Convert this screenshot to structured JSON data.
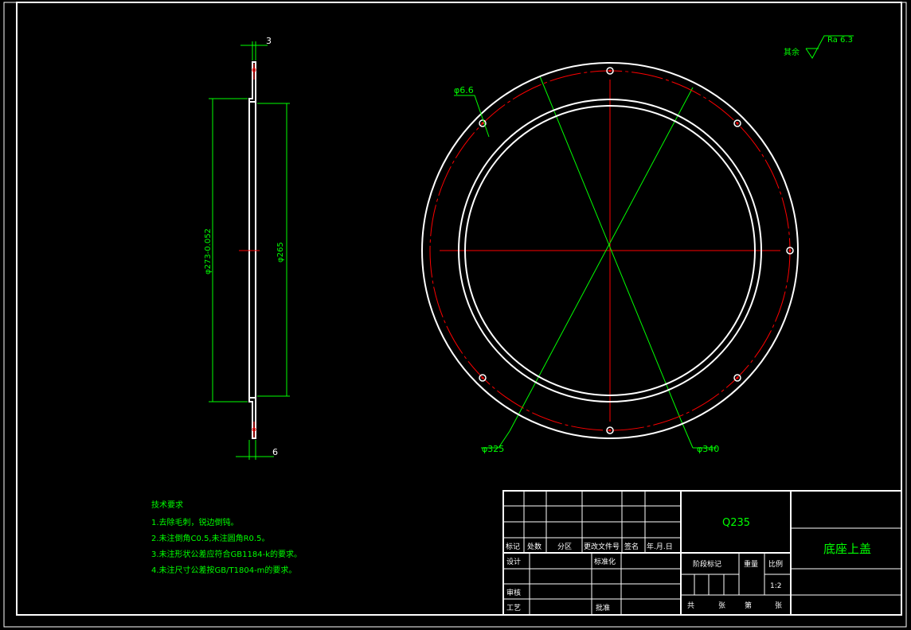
{
  "drawing": {
    "roughness": {
      "prefix": "其余",
      "value": "Ra 6.3"
    },
    "side_view": {
      "dim_top": "3",
      "dim_bottom": "6",
      "dim_outer": "φ273-0.052",
      "dim_inner": "φ265"
    },
    "front_view": {
      "hole_dim": "φ6.6",
      "bolt_circle_dim": "φ325",
      "outer_dim": "φ340"
    },
    "tech_requirements": {
      "title": "技术要求",
      "items": [
        "1.去除毛刺，锐边倒钝。",
        "2.未注倒角C0.5,未注圆角R0.5。",
        "3.未注形状公差应符合GB1184-k的要求。",
        "4.未注尺寸公差按GB/T1804-m的要求。"
      ]
    }
  },
  "title_block": {
    "material": "Q235",
    "part_name": "底座上盖",
    "rev_headers": [
      "标记",
      "处数",
      "分区",
      "更改文件号",
      "签名",
      "年.月.日"
    ],
    "row_labels": [
      "设计",
      "标准化",
      "审核",
      "工艺",
      "批准"
    ],
    "stage_label": "阶段标记",
    "weight_label": "重量",
    "scale_label": "比例",
    "scale_value": "1:2",
    "sheet_total": "共",
    "sheet_unit1": "张",
    "sheet_no": "第",
    "sheet_unit2": "张"
  }
}
